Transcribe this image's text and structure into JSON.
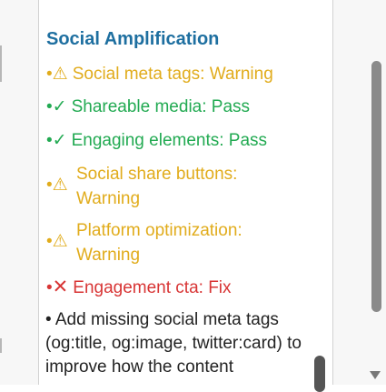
{
  "section": {
    "title": "Social Amplification",
    "checks": [
      {
        "status": "warning",
        "icon": "⚠",
        "label": "Social meta tags: Warning"
      },
      {
        "status": "pass",
        "icon": "✓",
        "label": "Shareable media: Pass"
      },
      {
        "status": "pass",
        "icon": "✓",
        "label": "Engaging elements: Pass"
      },
      {
        "status": "warning",
        "icon": "⚠",
        "label": "Social share buttons: Warning"
      },
      {
        "status": "warning",
        "icon": "⚠",
        "label": "Platform optimization: Warning"
      },
      {
        "status": "fix",
        "icon": "✕",
        "label": "Engagement cta: Fix"
      }
    ],
    "bullet": "•",
    "recommendation": "• Add missing social meta tags (og:title, og:image, twitter:card) to improve how the content"
  },
  "colors": {
    "title": "#1e6fa0",
    "pass": "#22aa52",
    "warning": "#e1ac1c",
    "fix": "#d83535"
  }
}
